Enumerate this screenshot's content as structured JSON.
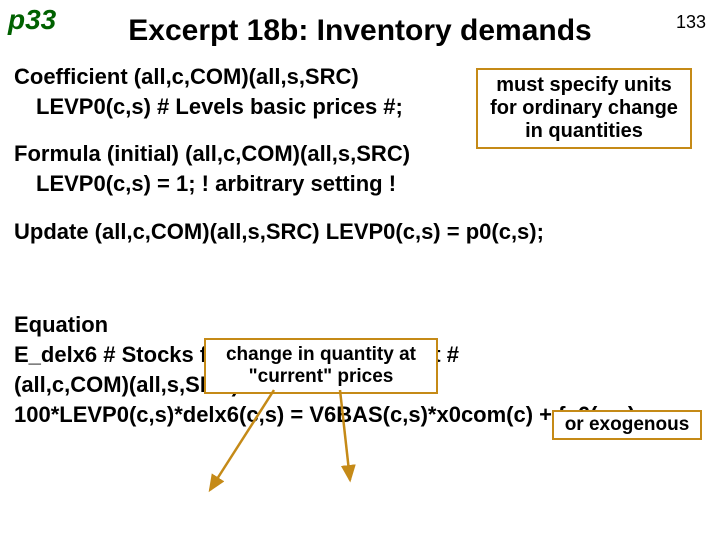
{
  "meta": {
    "page_ref": "p33",
    "slide_number": "133",
    "title": "Excerpt 18b: Inventory demands"
  },
  "coefficient": {
    "decl": "Coefficient (all,c,COM)(all,s,SRC)",
    "body": "LEVP0(c,s) # Levels basic prices #;"
  },
  "formula": {
    "decl": "Formula (initial) (all,c,COM)(all,s,SRC)",
    "body": "LEVP0(c,s) = 1; ! arbitrary setting !"
  },
  "update": {
    "line": "Update   (all,c,COM)(all,s,SRC) LEVP0(c,s) = p0(c,s);"
  },
  "equation": {
    "kw": "Equation",
    "name": "E_delx6 # Stocks follow domestic output #",
    "dom": "(all,c,COM)(all,s,SRC)",
    "body": "100*LEVP0(c,s)*delx6(c,s) = V6BAS(c,s)*x0com(c) + fx6(c,s);"
  },
  "callouts": {
    "units": "must specify units for ordinary change in quantities",
    "change": "change in quantity at \"current\" prices",
    "exogenous": "or exogenous"
  }
}
